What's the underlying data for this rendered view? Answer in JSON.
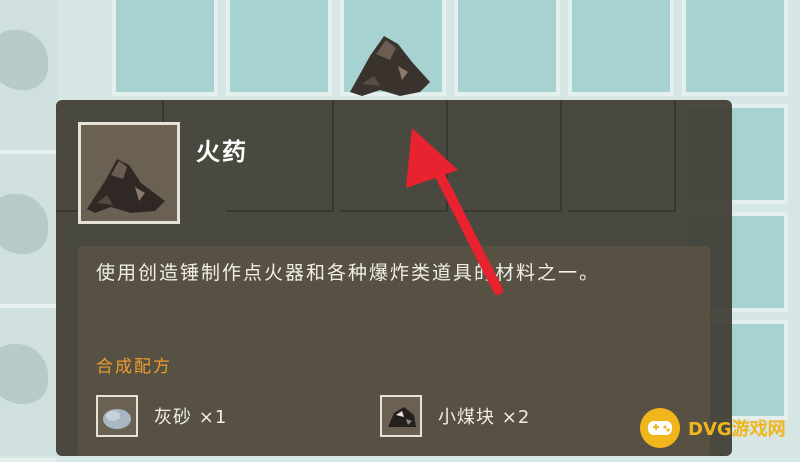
{
  "item": {
    "name": "火药",
    "description": "使用创造锤制作点火器和各种爆炸类道具的材料之一。"
  },
  "recipe": {
    "label": "合成配方",
    "ingredients": [
      {
        "name": "灰砂",
        "quantity": "×1",
        "icon": "gray-sand-icon"
      },
      {
        "name": "小煤块",
        "quantity": "×2",
        "icon": "small-coal-icon"
      }
    ]
  },
  "watermark": {
    "text": "DVG游戏网"
  },
  "colors": {
    "slot": "#a6d2d2",
    "panel": "#3e3c34",
    "recipe_label": "#ef9a2e",
    "arrow": "#e8222e",
    "watermark": "#f2b61d"
  }
}
